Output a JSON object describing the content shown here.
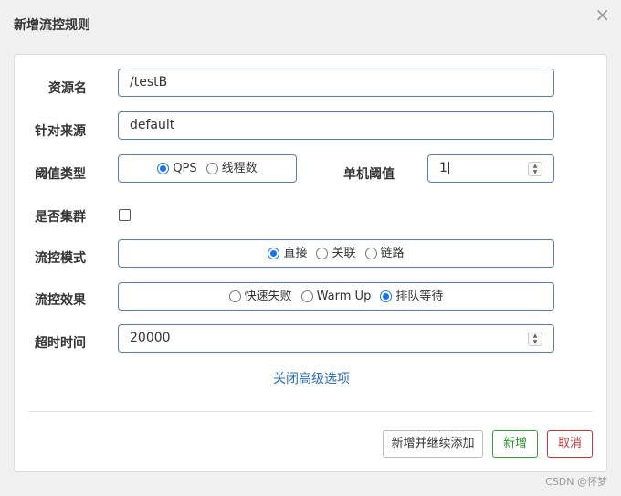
{
  "dialog": {
    "title": "新增流控规则",
    "close_symbol": "×"
  },
  "form": {
    "resource": {
      "label": "资源名",
      "value": "/testB"
    },
    "limit_app": {
      "label": "针对来源",
      "value": "default"
    },
    "grade": {
      "label": "阈值类型",
      "options": [
        {
          "label": "QPS",
          "checked": true
        },
        {
          "label": "线程数",
          "checked": false
        }
      ]
    },
    "threshold": {
      "label": "单机阈值",
      "value": "1"
    },
    "cluster": {
      "label": "是否集群",
      "checked": false
    },
    "strategy": {
      "label": "流控模式",
      "options": [
        {
          "label": "直接",
          "checked": true
        },
        {
          "label": "关联",
          "checked": false
        },
        {
          "label": "链路",
          "checked": false
        }
      ]
    },
    "control_behavior": {
      "label": "流控效果",
      "options": [
        {
          "label": "快速失败",
          "checked": false
        },
        {
          "label": "Warm Up",
          "checked": false
        },
        {
          "label": "排队等待",
          "checked": true
        }
      ]
    },
    "timeout": {
      "label": "超时时间",
      "value": "20000"
    },
    "advanced_link": "关闭高级选项"
  },
  "footer": {
    "add_continue_label": "新增并继续添加",
    "add_label": "新增",
    "cancel_label": "取消"
  },
  "watermark": "CSDN @怀梦",
  "colors": {
    "accent": "#1a73e8",
    "success": "#2d8a2d",
    "danger": "#c23b3b",
    "link": "#2a6bb5"
  }
}
